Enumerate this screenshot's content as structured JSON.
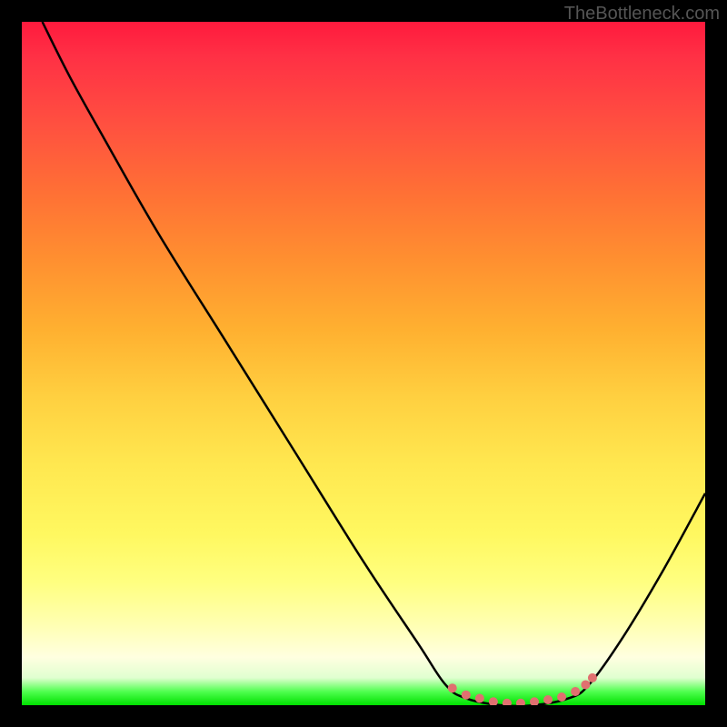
{
  "watermark": "TheBottleneck.com",
  "chart_data": {
    "type": "line",
    "title": "",
    "xlabel": "",
    "ylabel": "",
    "x_range": [
      0,
      100
    ],
    "y_range": [
      0,
      100
    ],
    "curve_points": [
      {
        "x": 3,
        "y": 100
      },
      {
        "x": 7,
        "y": 92
      },
      {
        "x": 12,
        "y": 83
      },
      {
        "x": 20,
        "y": 69
      },
      {
        "x": 30,
        "y": 53
      },
      {
        "x": 40,
        "y": 37
      },
      {
        "x": 50,
        "y": 21
      },
      {
        "x": 58,
        "y": 9
      },
      {
        "x": 62,
        "y": 3
      },
      {
        "x": 65,
        "y": 1
      },
      {
        "x": 70,
        "y": 0
      },
      {
        "x": 75,
        "y": 0
      },
      {
        "x": 80,
        "y": 1
      },
      {
        "x": 83,
        "y": 3
      },
      {
        "x": 88,
        "y": 10
      },
      {
        "x": 94,
        "y": 20
      },
      {
        "x": 100,
        "y": 31
      }
    ],
    "marker_points": [
      {
        "x": 63,
        "y": 2.5
      },
      {
        "x": 65,
        "y": 1.5
      },
      {
        "x": 67,
        "y": 1
      },
      {
        "x": 69,
        "y": 0.5
      },
      {
        "x": 71,
        "y": 0.3
      },
      {
        "x": 73,
        "y": 0.3
      },
      {
        "x": 75,
        "y": 0.5
      },
      {
        "x": 77,
        "y": 0.8
      },
      {
        "x": 79,
        "y": 1.2
      },
      {
        "x": 81,
        "y": 2
      },
      {
        "x": 82.5,
        "y": 3
      },
      {
        "x": 83.5,
        "y": 4
      }
    ],
    "gradient_colors": {
      "top": "#ff1a3d",
      "middle": "#ffd040",
      "bottom": "#00e000"
    },
    "curve_color": "#000000",
    "marker_color": "#e07070"
  }
}
